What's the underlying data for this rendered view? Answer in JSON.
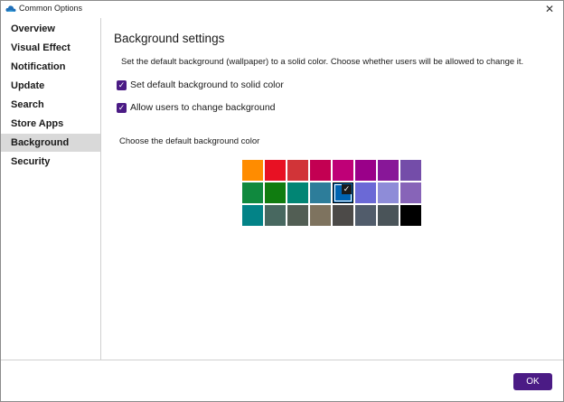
{
  "window": {
    "title": "Common Options",
    "close_glyph": "✕"
  },
  "sidebar": {
    "items": [
      {
        "label": "Overview"
      },
      {
        "label": "Visual Effect"
      },
      {
        "label": "Notification"
      },
      {
        "label": "Update"
      },
      {
        "label": "Search"
      },
      {
        "label": "Store Apps"
      },
      {
        "label": "Background",
        "selected": true
      },
      {
        "label": "Security"
      }
    ]
  },
  "content": {
    "heading": "Background settings",
    "description": "Set the default background (wallpaper) to a solid color. Choose whether users will be allowed to change it.",
    "checkboxes": [
      {
        "label": "Set default background to solid color",
        "checked": true
      },
      {
        "label": "Allow users to change background",
        "checked": true
      }
    ],
    "color_picker_label": "Choose the default background color",
    "colors": [
      [
        "#ff8c00",
        "#e81123",
        "#d13438",
        "#c30052",
        "#bf0077",
        "#9a0089",
        "#881798",
        "#744da9"
      ],
      [
        "#10893e",
        "#107c10",
        "#018574",
        "#2d7d9a",
        "#0063b1",
        "#6b69d6",
        "#8e8cd8",
        "#8764b8"
      ],
      [
        "#038387",
        "#486860",
        "#525e54",
        "#7e735f",
        "#4c4a48",
        "#515c6b",
        "#4a5459",
        "#000000"
      ]
    ],
    "selected_color": "#0063b1",
    "accent_color": "#4b1b85"
  },
  "footer": {
    "ok_label": "OK"
  }
}
